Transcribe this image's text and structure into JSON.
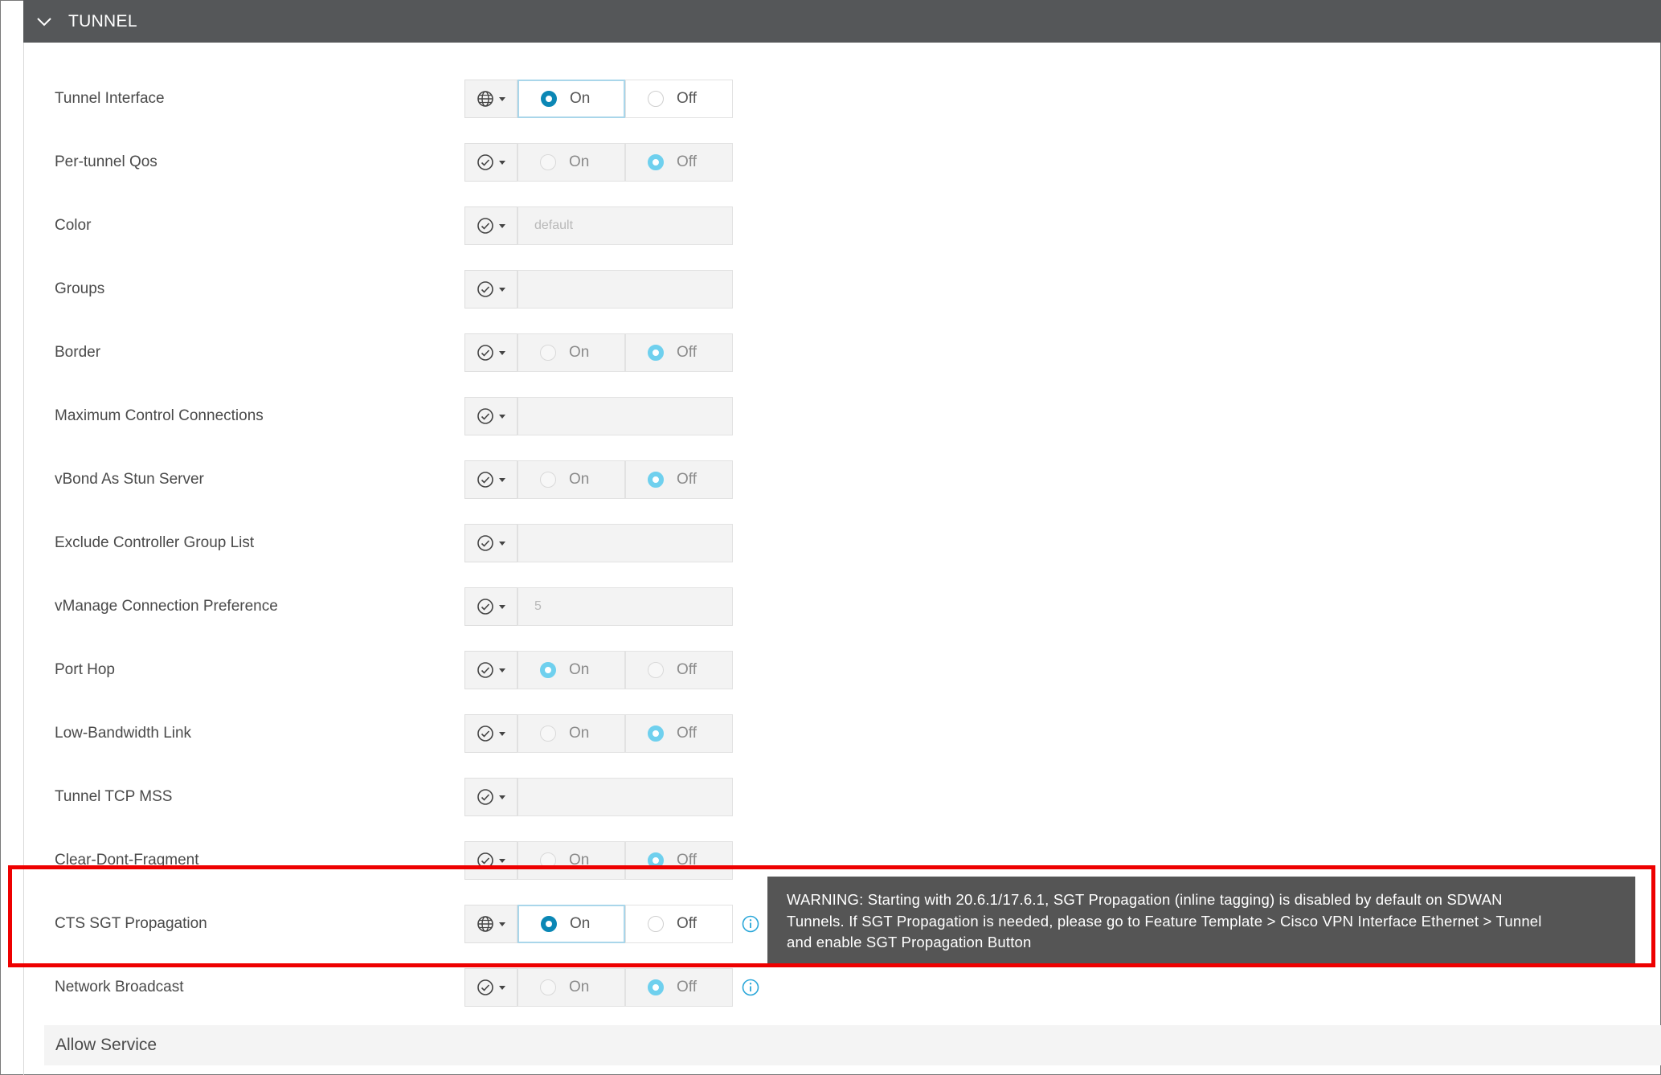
{
  "section": {
    "title": "TUNNEL"
  },
  "rows": [
    {
      "label": "Tunnel Interface",
      "scope": "global",
      "kind": "toggle",
      "on": "On",
      "off": "Off",
      "selected": "on"
    },
    {
      "label": "Per-tunnel Qos",
      "scope": "default",
      "kind": "toggle",
      "on": "On",
      "off": "Off",
      "selected": "off"
    },
    {
      "label": "Color",
      "scope": "default",
      "kind": "text",
      "value": "default"
    },
    {
      "label": "Groups",
      "scope": "default",
      "kind": "text",
      "value": ""
    },
    {
      "label": "Border",
      "scope": "default",
      "kind": "toggle",
      "on": "On",
      "off": "Off",
      "selected": "off"
    },
    {
      "label": "Maximum Control Connections",
      "scope": "default",
      "kind": "text",
      "value": ""
    },
    {
      "label": "vBond As Stun Server",
      "scope": "default",
      "kind": "toggle",
      "on": "On",
      "off": "Off",
      "selected": "off"
    },
    {
      "label": "Exclude Controller Group List",
      "scope": "default",
      "kind": "text",
      "value": ""
    },
    {
      "label": "vManage Connection Preference",
      "scope": "default",
      "kind": "text",
      "value": "5"
    },
    {
      "label": "Port Hop",
      "scope": "default",
      "kind": "toggle",
      "on": "On",
      "off": "Off",
      "selected": "on"
    },
    {
      "label": "Low-Bandwidth Link",
      "scope": "default",
      "kind": "toggle",
      "on": "On",
      "off": "Off",
      "selected": "off"
    },
    {
      "label": "Tunnel TCP MSS",
      "scope": "default",
      "kind": "text",
      "value": ""
    },
    {
      "label": "Clear-Dont-Fragment",
      "scope": "default",
      "kind": "toggle",
      "on": "On",
      "off": "Off",
      "selected": "off"
    },
    {
      "label": "CTS SGT Propagation",
      "scope": "global",
      "kind": "toggle",
      "on": "On",
      "off": "Off",
      "selected": "on",
      "info": true
    },
    {
      "label": "Network Broadcast",
      "scope": "default",
      "kind": "toggle",
      "on": "On",
      "off": "Off",
      "selected": "off",
      "info": true
    }
  ],
  "tooltip": {
    "line1": "WARNING: Starting with 20.6.1/17.6.1, SGT Propagation (inline tagging) is disabled by default on SDWAN",
    "line2": "Tunnels. If SGT Propagation is needed, please go to Feature Template > Cisco VPN Interface Ethernet > Tunnel",
    "line3": "and enable SGT Propagation Button"
  },
  "allow_service": {
    "title": "Allow Service"
  },
  "colors": {
    "header_bg": "#555759",
    "radio_active": "#0b87b5",
    "radio_default": "#6fd0ee",
    "highlight": "#ee0000",
    "info": "#2aa7d9"
  },
  "icons": {
    "header": "chevron-down-icon",
    "scope_global": "globe-icon",
    "scope_default": "check-circle-icon",
    "info": "info-icon"
  }
}
